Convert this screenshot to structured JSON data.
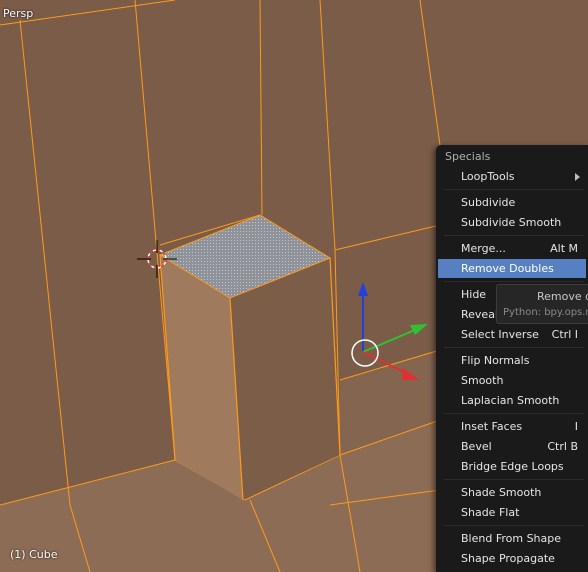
{
  "viewport": {
    "view_label": "Persp",
    "object_label": "(1) Cube"
  },
  "menu": {
    "title": "Specials",
    "items": [
      {
        "label": "LoopTools",
        "shortcut": "",
        "submenu": true
      },
      {
        "label": "Subdivide",
        "shortcut": ""
      },
      {
        "label": "Subdivide Smooth",
        "shortcut": ""
      },
      {
        "label": "Merge...",
        "shortcut": "Alt M"
      },
      {
        "label": "Remove Doubles",
        "shortcut": "",
        "active": true
      },
      {
        "label": "Hide",
        "shortcut": ""
      },
      {
        "label": "Reveal",
        "shortcut": ""
      },
      {
        "label": "Select Inverse",
        "shortcut": "Ctrl I"
      },
      {
        "label": "Flip Normals",
        "shortcut": ""
      },
      {
        "label": "Smooth",
        "shortcut": ""
      },
      {
        "label": "Laplacian Smooth",
        "shortcut": ""
      },
      {
        "label": "Inset Faces",
        "shortcut": "I"
      },
      {
        "label": "Bevel",
        "shortcut": "Ctrl B"
      },
      {
        "label": "Bridge Edge Loops",
        "shortcut": ""
      },
      {
        "label": "Shade Smooth",
        "shortcut": ""
      },
      {
        "label": "Shade Flat",
        "shortcut": ""
      },
      {
        "label": "Blend From Shape",
        "shortcut": ""
      },
      {
        "label": "Shape Propagate",
        "shortcut": ""
      }
    ]
  },
  "tooltip": {
    "title": "Remove d",
    "python": "Python: bpy.ops.m"
  },
  "colors": {
    "mesh_face": "#7a5c48",
    "mesh_face_light": "#8c6c55",
    "edge_selected": "#ff9a1a",
    "menu_bg": "#1a1a1a",
    "menu_highlight": "#5680c2",
    "gizmo_x": "#e03030",
    "gizmo_y": "#30c030",
    "gizmo_z": "#2040e0"
  }
}
